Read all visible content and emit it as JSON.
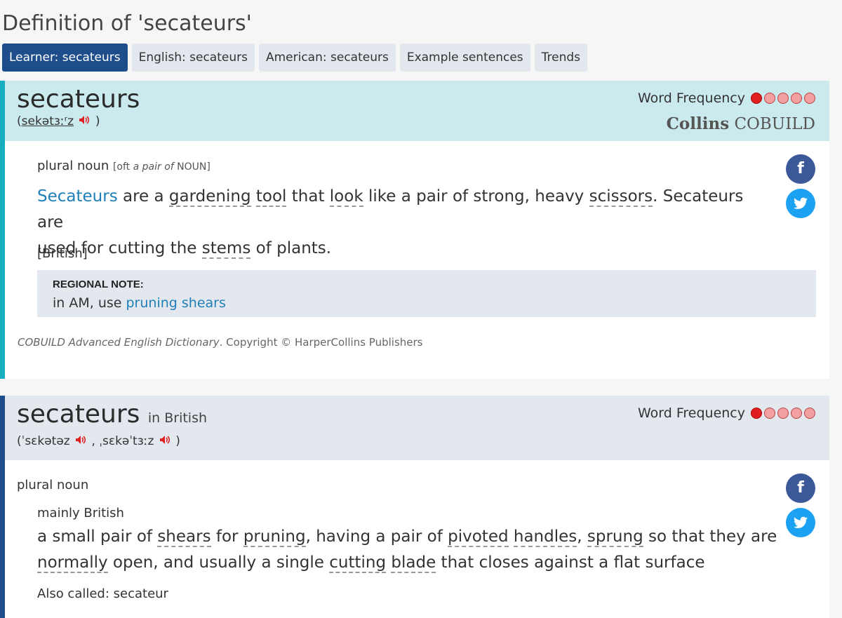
{
  "page": {
    "title": "Definition of 'secateurs'"
  },
  "tabs": [
    {
      "label": "Learner: secateurs"
    },
    {
      "label": "English: secateurs"
    },
    {
      "label": "American: secateurs"
    },
    {
      "label": "Example sentences"
    },
    {
      "label": "Trends"
    }
  ],
  "entry1": {
    "headword": "secateurs",
    "pron_open": "(",
    "pron": "sekətɜːʳz",
    "pron_close": ")",
    "speaker_icon": "speaker-icon",
    "word_frequency_label": "Word Frequency",
    "frequency_level": 1,
    "frequency_max": 5,
    "brand_bold": "Collins",
    "brand_rest": "COBUILD",
    "pos": "plural noun",
    "pos_note_a": "[oft",
    "pos_note_b": "a pair of",
    "pos_note_c": "NOUN]",
    "def": {
      "w1": "Secateurs",
      "t1": " are a ",
      "w2": "gardening",
      "t2": " ",
      "w3": "tool",
      "t3": " that ",
      "w4": "look",
      "t4": " like a pair of strong, heavy ",
      "w5": "scissors",
      "t5": ". Secateurs are",
      "t6": "used for cutting the ",
      "w6": "stems",
      "t7": " of plants."
    },
    "region": "[British]",
    "note_title": "REGIONAL NOTE:",
    "note_text": "in AM, use ",
    "note_link": "pruning shears",
    "copyright_italic": "COBUILD Advanced English Dictionary",
    "copyright_rest": ". Copyright © HarperCollins Publishers"
  },
  "entry2": {
    "headword": "secateurs",
    "in_label": "in British",
    "pron_open": "(",
    "pron1": "ˈsɛkətəz",
    "pron_sep": ",",
    "pron2": "ˌsɛkəˈtɜːz",
    "pron_close": ")",
    "word_frequency_label": "Word Frequency",
    "frequency_level": 1,
    "frequency_max": 5,
    "pos": "plural noun",
    "usage": "mainly British",
    "def": {
      "t1": "a small pair of ",
      "w1": "shears",
      "t2": " for ",
      "w2": "pruning",
      "t3": ", having a pair of ",
      "w3": "pivoted",
      "t4": " ",
      "w4": "handles",
      "t5": ", ",
      "w5": "sprung",
      "t6": " so that they are",
      "w6": "normally",
      "t7": " open, and usually a single ",
      "w7": "cutting",
      "t8": " ",
      "w8": "blade",
      "t9": " that closes against a flat surface"
    },
    "also": "Also called: secateur"
  },
  "social": {
    "facebook": "f",
    "twitter": "twitter-icon"
  },
  "colors": {
    "accent_teal": "#17aebf",
    "accent_navy": "#1e4d8c",
    "tab_active": "#1e4d8c",
    "freq_on": "#e02020",
    "freq_off": "#f3a0a0"
  }
}
